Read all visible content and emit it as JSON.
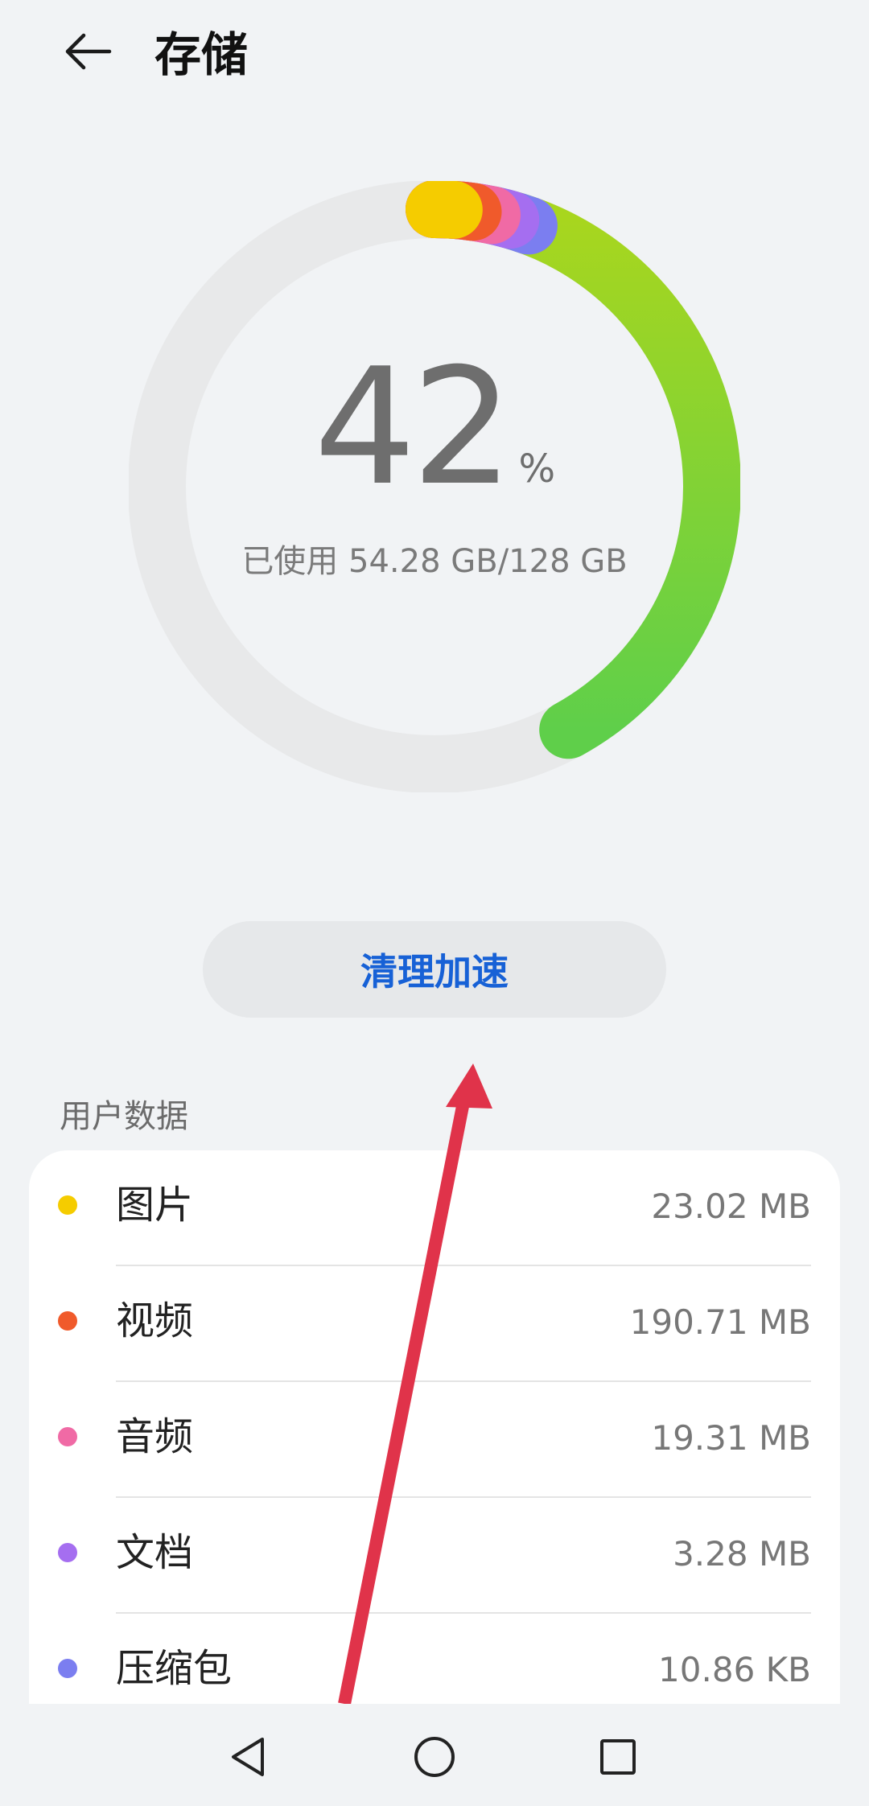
{
  "header": {
    "title": "存储"
  },
  "storage": {
    "percent": "42",
    "percent_sign": "%",
    "used_text": "已使用 54.28 GB/128 GB",
    "used_fraction": 0.42
  },
  "clean_button": {
    "label": "清理加速"
  },
  "section": {
    "title": "用户数据"
  },
  "items": [
    {
      "label": "图片",
      "value": "23.02 MB",
      "color": "#f5cc00"
    },
    {
      "label": "视频",
      "value": "190.71 MB",
      "color": "#f05a2b"
    },
    {
      "label": "音频",
      "value": "19.31 MB",
      "color": "#f06aa5"
    },
    {
      "label": "文档",
      "value": "3.28 MB",
      "color": "#a56ef0"
    },
    {
      "label": "压缩包",
      "value": "10.86 KB",
      "color": "#7b7ef0"
    }
  ],
  "ring_colors": {
    "track": "#e8e9ea",
    "main_start": "#a8d61e",
    "main_end": "#5fcf4a",
    "segments": [
      "#f5cc00",
      "#f05a2b",
      "#f06aa5",
      "#a56ef0",
      "#7b7ef0"
    ]
  },
  "annotation_color": "#e0334a",
  "nav": {
    "icons": [
      "back-triangle-icon",
      "home-circle-icon",
      "recents-square-icon"
    ]
  }
}
